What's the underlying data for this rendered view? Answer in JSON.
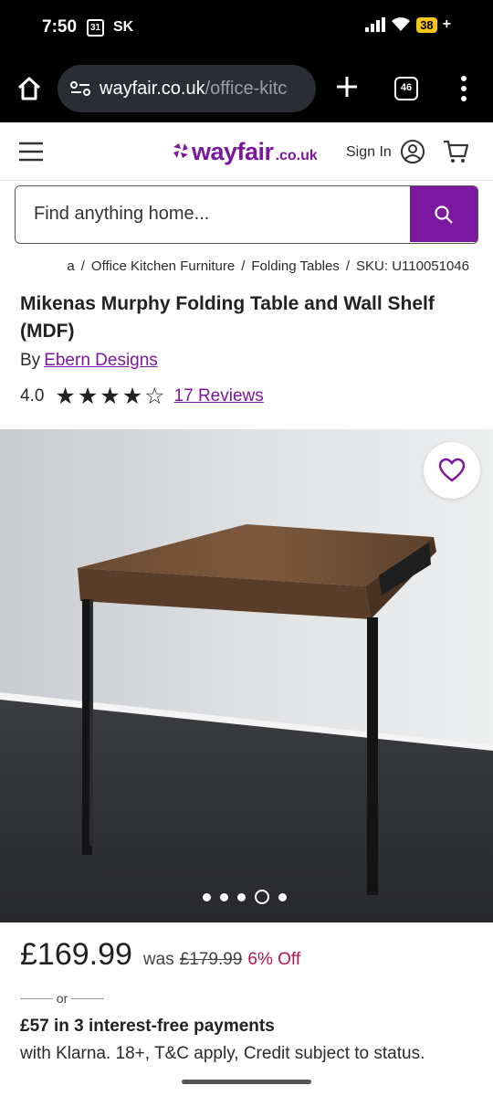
{
  "status_bar": {
    "time": "7:50",
    "calendar_day": "31",
    "carrier": "SK",
    "battery": "38"
  },
  "browser": {
    "url_host": "wayfair.co.uk",
    "url_path": "/office-kitc",
    "tab_count": "46"
  },
  "header": {
    "logo_main": "wayfair",
    "logo_sub": ".co.uk",
    "sign_in_label": "Sign In"
  },
  "search": {
    "placeholder": "Find anything home..."
  },
  "breadcrumb": {
    "items": [
      "a",
      "Office Kitchen Furniture",
      "Folding Tables",
      "SKU: U110051046"
    ]
  },
  "product": {
    "title": "Mikenas Murphy Folding Table and Wall Shelf (MDF)",
    "by_prefix": "By",
    "brand": "Ebern Designs",
    "rating": "4.0",
    "stars_filled": 4,
    "stars_total": 5,
    "reviews_label": "17 Reviews",
    "image_count": 5,
    "image_active_index": 3
  },
  "pricing": {
    "price": "£169.99",
    "was_label": "was",
    "was_price": "£179.99",
    "discount": "6% Off",
    "or_label": "or",
    "klarna_headline": "£57 in 3 interest-free payments",
    "klarna_detail": "with Klarna. 18+, T&C apply, Credit subject to status."
  },
  "colors": {
    "brand": "#7b189f",
    "discount": "#b5174b"
  }
}
